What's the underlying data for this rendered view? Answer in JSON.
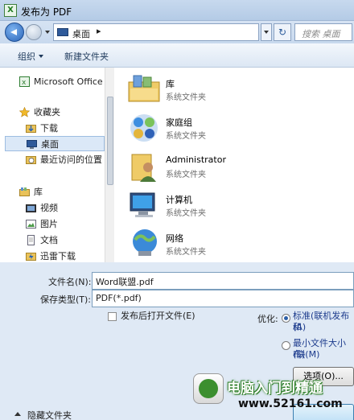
{
  "window": {
    "title": "发布为 PDF",
    "app_icon_letter": "X"
  },
  "address_bar": {
    "location": "桌面",
    "separator": "▸",
    "search_placeholder": "搜索 桌面",
    "refresh_glyph": "↻"
  },
  "toolbar": {
    "organize": "组织",
    "new_folder": "新建文件夹"
  },
  "sidebar": {
    "items": [
      {
        "label": "Microsoft Office",
        "icon": "excel-icon",
        "selected": false
      },
      {
        "label": "收藏夹",
        "icon": "star-icon",
        "selected": false
      },
      {
        "label": "下载",
        "icon": "download-folder-icon",
        "selected": false
      },
      {
        "label": "桌面",
        "icon": "desktop-icon",
        "selected": true
      },
      {
        "label": "最近访问的位置",
        "icon": "recent-places-icon",
        "selected": false
      },
      {
        "label": "库",
        "icon": "library-icon",
        "selected": false
      },
      {
        "label": "视频",
        "icon": "video-icon",
        "selected": false
      },
      {
        "label": "图片",
        "icon": "picture-icon",
        "selected": false
      },
      {
        "label": "文档",
        "icon": "document-icon",
        "selected": false
      },
      {
        "label": "迅雷下载",
        "icon": "thunder-download-icon",
        "selected": false
      }
    ]
  },
  "files": [
    {
      "name": "库",
      "type": "系统文件夹",
      "icon": "library-icon"
    },
    {
      "name": "家庭组",
      "type": "系统文件夹",
      "icon": "homegroup-icon"
    },
    {
      "name": "Administrator",
      "type": "系统文件夹",
      "icon": "user-folder-icon"
    },
    {
      "name": "计算机",
      "type": "系统文件夹",
      "icon": "computer-icon"
    },
    {
      "name": "网络",
      "type": "系统文件夹",
      "icon": "network-icon"
    }
  ],
  "form": {
    "filename_label": "文件名(N):",
    "filename_value": "Word联盟.pdf",
    "savetype_label": "保存类型(T):",
    "savetype_value": "PDF(*.pdf)",
    "open_after_label": "发布后打开文件(E)",
    "optimize_label": "优化:",
    "option_standard_line1": "标准(联机发布和",
    "option_standard_line2": "(A)",
    "option_minsize_line1": "最小文件大小(联",
    "option_minsize_line2": "布)(M)",
    "options_button": "选项(O)..."
  },
  "footer": {
    "hide_folders": "隐藏文件夹"
  },
  "watermark": {
    "title": "电脑入门到精通",
    "url": "www.52161.com"
  }
}
